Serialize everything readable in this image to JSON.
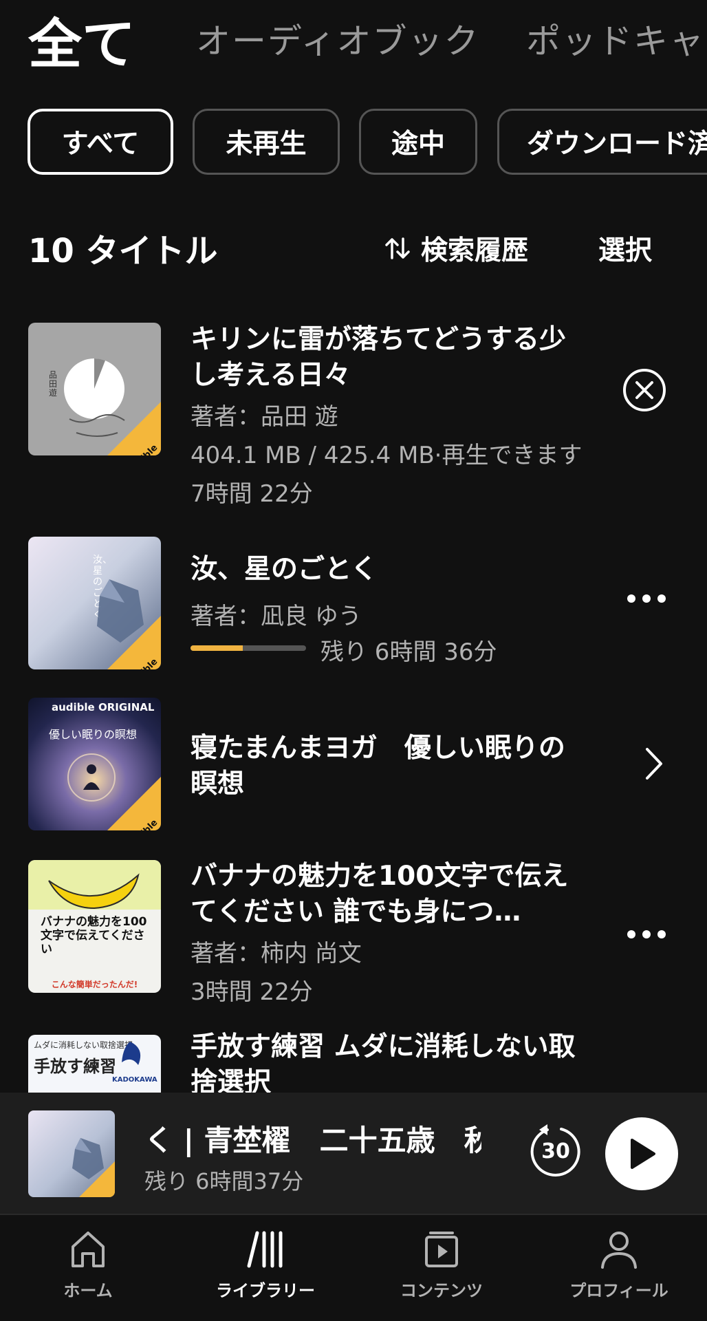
{
  "top_tabs": [
    {
      "label": "全て",
      "active": true
    },
    {
      "label": "オーディオブック",
      "active": false
    },
    {
      "label": "ポッドキャ",
      "active": false
    }
  ],
  "filters": [
    {
      "label": "すべて",
      "active": true
    },
    {
      "label": "未再生",
      "active": false
    },
    {
      "label": "途中",
      "active": false
    },
    {
      "label": "ダウンロード済",
      "active": false
    }
  ],
  "list_header": {
    "count_label": "10 タイトル",
    "sort_label": "検索履歴",
    "select_label": "選択"
  },
  "items": [
    {
      "title": "キリンに雷が落ちてどうする少し考える日々",
      "author": "著者：品田 遊",
      "download_status": "404.1 MB / 425.4 MB·再生できます",
      "duration": "7時間 22分",
      "action_icon": "cancel-download-icon",
      "cover_text": "品田遊",
      "badge_text": "audible"
    },
    {
      "title": "汝、星のごとく",
      "author": "著者：凪良 ゆう",
      "progress": 0.45,
      "remaining": "残り 6時間 36分",
      "action_icon": "more-icon",
      "cover_text": "汝、星のごとく",
      "badge_text": "audible"
    },
    {
      "title": "寝たまんまヨガ　優しい眠りの瞑想",
      "action_icon": "chevron-right-icon",
      "cover_top_text": "audible ORIGINAL",
      "cover_text": "優しい眠りの瞑想",
      "badge_text": "audible"
    },
    {
      "title": "バナナの魅力を100文字で伝えてください 誰でも身につ…",
      "author": "著者：柿内 尚文",
      "duration": "3時間 22分",
      "action_icon": "more-icon",
      "cover_text": "バナナの魅力を100文字で伝えてください",
      "cover_bottom_text": "こんな簡単だったんだ!"
    },
    {
      "title": "手放す練習 ムダに消耗しない取捨選択",
      "action_icon": "more-icon",
      "cover_top_text": "ムダに消耗しない取捨選択",
      "cover_text": "手放す練習",
      "cover_publisher": "KADOKAWA"
    }
  ],
  "mini_player": {
    "title": "く | 青埜櫂　二十五歳　秋",
    "remaining": "残り 6時間37分",
    "skip_seconds": "30"
  },
  "nav": [
    {
      "label": "ホーム",
      "icon": "home-icon",
      "active": false
    },
    {
      "label": "ライブラリー",
      "icon": "library-icon",
      "active": true
    },
    {
      "label": "コンテンツ",
      "icon": "content-icon",
      "active": false
    },
    {
      "label": "プロフィール",
      "icon": "profile-icon",
      "active": false
    }
  ],
  "colors": {
    "background": "#111111",
    "progress": "#f0b341",
    "badge": "#f4b73b"
  }
}
